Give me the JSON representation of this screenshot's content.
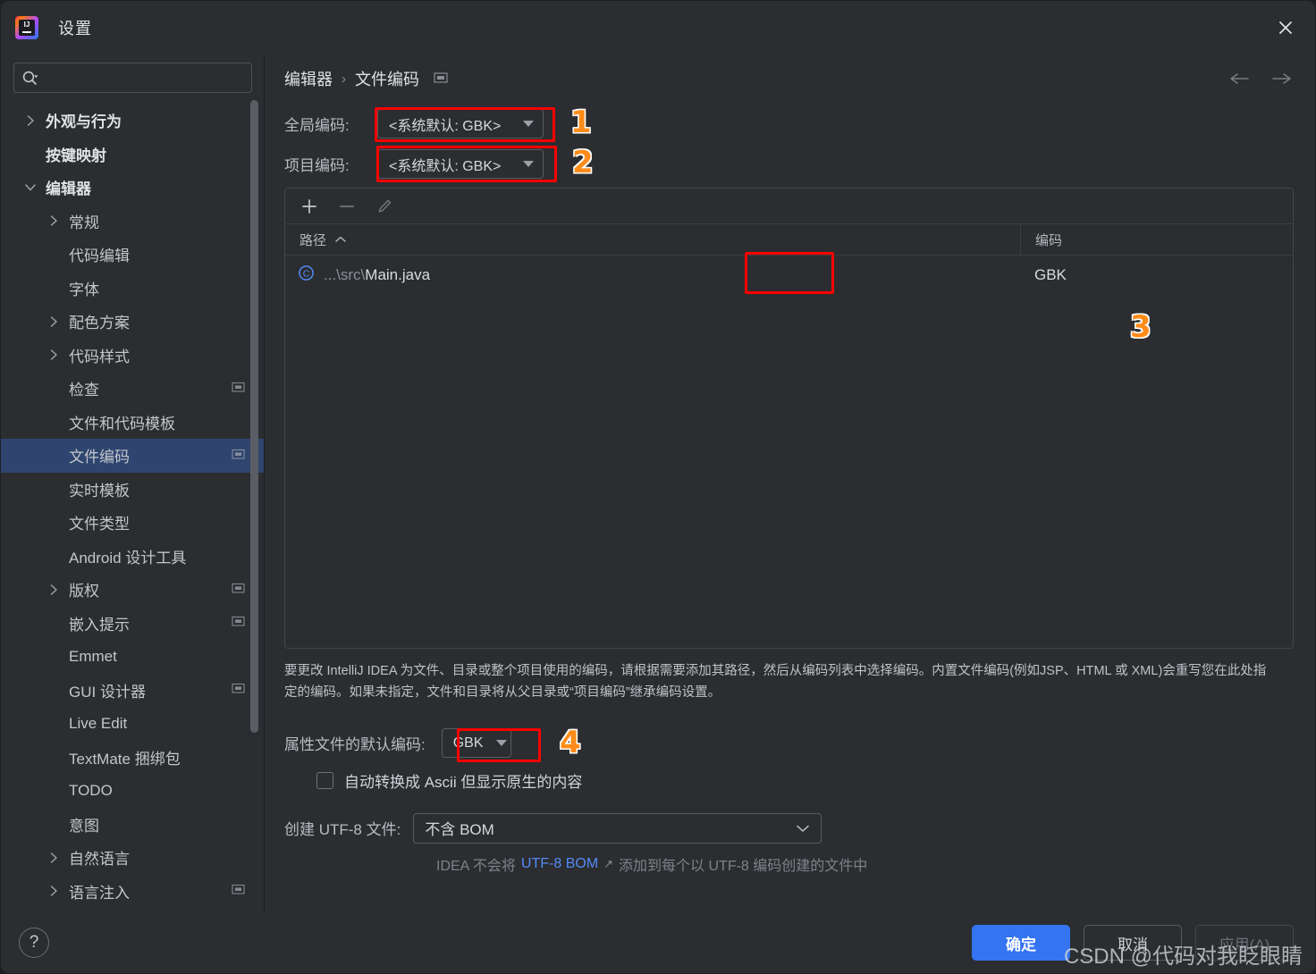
{
  "window": {
    "title": "设置",
    "app_icon": "intellij-idea-icon",
    "close_icon": "close-icon"
  },
  "search": {
    "placeholder": "",
    "value": "",
    "icon": "search-icon"
  },
  "sidebar": {
    "items": [
      {
        "label": "外观与行为",
        "indent": 0,
        "arrow": "chevron-right",
        "bold": true,
        "selected": false,
        "trailing": ""
      },
      {
        "label": "按键映射",
        "indent": 0,
        "arrow": "none",
        "bold": true,
        "selected": false,
        "trailing": ""
      },
      {
        "label": "编辑器",
        "indent": 0,
        "arrow": "chevron-down",
        "bold": true,
        "selected": false,
        "trailing": ""
      },
      {
        "label": "常规",
        "indent": 1,
        "arrow": "chevron-right",
        "bold": false,
        "selected": false,
        "trailing": ""
      },
      {
        "label": "代码编辑",
        "indent": 1,
        "arrow": "none",
        "bold": false,
        "selected": false,
        "trailing": ""
      },
      {
        "label": "字体",
        "indent": 1,
        "arrow": "none",
        "bold": false,
        "selected": false,
        "trailing": ""
      },
      {
        "label": "配色方案",
        "indent": 1,
        "arrow": "chevron-right",
        "bold": false,
        "selected": false,
        "trailing": ""
      },
      {
        "label": "代码样式",
        "indent": 1,
        "arrow": "chevron-right",
        "bold": false,
        "selected": false,
        "trailing": ""
      },
      {
        "label": "检查",
        "indent": 1,
        "arrow": "none",
        "bold": false,
        "selected": false,
        "trailing": "project-scope-icon"
      },
      {
        "label": "文件和代码模板",
        "indent": 1,
        "arrow": "none",
        "bold": false,
        "selected": false,
        "trailing": ""
      },
      {
        "label": "文件编码",
        "indent": 1,
        "arrow": "none",
        "bold": false,
        "selected": true,
        "trailing": "project-scope-icon"
      },
      {
        "label": "实时模板",
        "indent": 1,
        "arrow": "none",
        "bold": false,
        "selected": false,
        "trailing": ""
      },
      {
        "label": "文件类型",
        "indent": 1,
        "arrow": "none",
        "bold": false,
        "selected": false,
        "trailing": ""
      },
      {
        "label": "Android 设计工具",
        "indent": 1,
        "arrow": "none",
        "bold": false,
        "selected": false,
        "trailing": ""
      },
      {
        "label": "版权",
        "indent": 1,
        "arrow": "chevron-right",
        "bold": false,
        "selected": false,
        "trailing": "project-scope-icon"
      },
      {
        "label": "嵌入提示",
        "indent": 1,
        "arrow": "none",
        "bold": false,
        "selected": false,
        "trailing": "project-scope-icon"
      },
      {
        "label": "Emmet",
        "indent": 1,
        "arrow": "none",
        "bold": false,
        "selected": false,
        "trailing": ""
      },
      {
        "label": "GUI 设计器",
        "indent": 1,
        "arrow": "none",
        "bold": false,
        "selected": false,
        "trailing": "project-scope-icon"
      },
      {
        "label": "Live Edit",
        "indent": 1,
        "arrow": "none",
        "bold": false,
        "selected": false,
        "trailing": ""
      },
      {
        "label": "TextMate 捆绑包",
        "indent": 1,
        "arrow": "none",
        "bold": false,
        "selected": false,
        "trailing": ""
      },
      {
        "label": "TODO",
        "indent": 1,
        "arrow": "none",
        "bold": false,
        "selected": false,
        "trailing": ""
      },
      {
        "label": "意图",
        "indent": 1,
        "arrow": "none",
        "bold": false,
        "selected": false,
        "trailing": ""
      },
      {
        "label": "自然语言",
        "indent": 1,
        "arrow": "chevron-right",
        "bold": false,
        "selected": false,
        "trailing": ""
      },
      {
        "label": "语言注入",
        "indent": 1,
        "arrow": "chevron-right",
        "bold": false,
        "selected": false,
        "trailing": "project-scope-icon"
      }
    ]
  },
  "breadcrumb": {
    "parent": "编辑器",
    "separator": "›",
    "current": "文件编码",
    "icon": "project-scope-icon",
    "back_icon": "arrow-left-icon",
    "forward_icon": "arrow-right-icon"
  },
  "fields": {
    "global_encoding_label": "全局编码:",
    "global_encoding_value": "<系统默认: GBK>",
    "project_encoding_label": "项目编码:",
    "project_encoding_value": "<系统默认: GBK>"
  },
  "table": {
    "toolbar": {
      "add_icon": "plus-icon",
      "remove_icon": "minus-icon",
      "edit_icon": "pencil-icon"
    },
    "columns": [
      "路径",
      "编码"
    ],
    "sort_indicator": "^",
    "rows": [
      {
        "icon": "java-class-icon",
        "path_prefix": "...\\src\\",
        "path_name": "Main.java",
        "encoding": "GBK"
      }
    ]
  },
  "description": "要更改 IntelliJ IDEA 为文件、目录或整个项目使用的编码，请根据需要添加其路径，然后从编码列表中选择编码。内置文件编码(例如JSP、HTML 或 XML)会重写您在此处指定的编码。如果未指定，文件和目录将从父目录或“项目编码”继承编码设置。",
  "options": {
    "properties_encoding_label": "属性文件的默认编码:",
    "properties_encoding_value": "GBK",
    "transparent_ascii_label": "自动转换成 Ascii 但显示原生的内容",
    "transparent_ascii_checked": false,
    "utf8_label": "创建 UTF-8 文件:",
    "utf8_value": "不含 BOM",
    "hint_prefix": "IDEA 不会将",
    "hint_link": "UTF-8 BOM",
    "hint_external_icon": "↗",
    "hint_suffix": "添加到每个以 UTF-8 编码创建的文件中"
  },
  "annotations": [
    {
      "number": "1"
    },
    {
      "number": "2"
    },
    {
      "number": "3"
    },
    {
      "number": "4"
    }
  ],
  "footer": {
    "help_label": "?",
    "ok_label": "确定",
    "cancel_label": "取消",
    "apply_label": "应用(A)",
    "watermark": "CSDN @代码对我眨眼睛"
  },
  "colors": {
    "accent": "#3574f0",
    "annotation": "#ff8c1a",
    "highlight_box": "#ff0000",
    "selection": "#2f4570",
    "link": "#548af7"
  }
}
